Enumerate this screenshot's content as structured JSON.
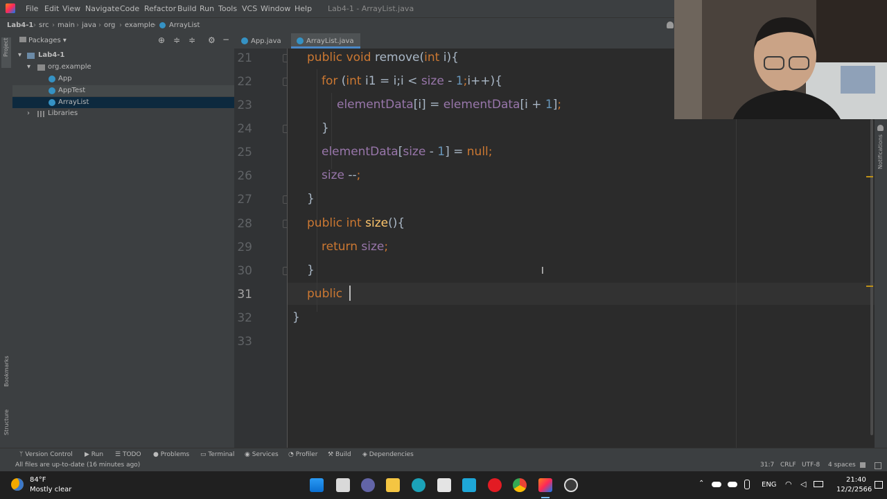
{
  "window": {
    "title": "Lab4-1 - ArrayList.java"
  },
  "menu": [
    "File",
    "Edit",
    "View",
    "Navigate",
    "Code",
    "Refactor",
    "Build",
    "Run",
    "Tools",
    "VCS",
    "Window",
    "Help"
  ],
  "breadcrumb": [
    "Lab4-1",
    "src",
    "main",
    "java",
    "org",
    "example",
    "ArrayList"
  ],
  "project_panel": {
    "title": "Packages",
    "tree": [
      {
        "label": "Lab4-1",
        "indent": 0,
        "expanded": true
      },
      {
        "label": "org.example",
        "indent": 1,
        "expanded": true
      },
      {
        "label": "App",
        "indent": 2
      },
      {
        "label": "AppTest",
        "indent": 2,
        "highlight": "test"
      },
      {
        "label": "ArrayList",
        "indent": 2,
        "selected": true
      },
      {
        "label": "Libraries",
        "indent": 1,
        "expanded": false
      }
    ]
  },
  "tabs": [
    {
      "label": "App.java",
      "active": false
    },
    {
      "label": "ArrayList.java",
      "active": true
    }
  ],
  "editor": {
    "line_numbers": [
      "21",
      "22",
      "23",
      "24",
      "25",
      "26",
      "27",
      "28",
      "29",
      "30",
      "31",
      "32",
      "33"
    ],
    "current_line": "31",
    "lines": [
      [
        [
          "kw",
          "public "
        ],
        [
          "kw",
          "void "
        ],
        [
          "plain",
          "remove("
        ],
        [
          "kw",
          "int "
        ],
        [
          "plain",
          "i){"
        ]
      ],
      [
        [
          "kw",
          "for "
        ],
        [
          "plain",
          "("
        ],
        [
          "kw",
          "int "
        ],
        [
          "plain",
          "i1 = i;i < "
        ],
        [
          "fld",
          "size"
        ],
        [
          "plain",
          " - "
        ],
        [
          "num",
          "1"
        ],
        [
          "kw",
          ";"
        ],
        [
          "plain",
          "i++){"
        ]
      ],
      [
        [
          "fld",
          "elementData"
        ],
        [
          "plain",
          "[i] = "
        ],
        [
          "fld",
          "elementData"
        ],
        [
          "plain",
          "[i + "
        ],
        [
          "num",
          "1"
        ],
        [
          "plain",
          "]"
        ],
        [
          "kw",
          ";"
        ]
      ],
      [
        [
          "plain",
          "}"
        ]
      ],
      [
        [
          "fld",
          "elementData"
        ],
        [
          "plain",
          "["
        ],
        [
          "fld",
          "size"
        ],
        [
          "plain",
          " - "
        ],
        [
          "num",
          "1"
        ],
        [
          "plain",
          "] = "
        ],
        [
          "kw",
          "null"
        ],
        [
          "kw",
          ";"
        ]
      ],
      [
        [
          "fld",
          "size"
        ],
        [
          "plain",
          " --"
        ],
        [
          "kw",
          ";"
        ]
      ],
      [
        [
          "plain",
          "}"
        ]
      ],
      [
        [
          "kw",
          "public "
        ],
        [
          "kw",
          "int "
        ],
        [
          "fn",
          "size"
        ],
        [
          "plain",
          "(){"
        ]
      ],
      [
        [
          "kw",
          "return "
        ],
        [
          "fld",
          "size"
        ],
        [
          "kw",
          ";"
        ]
      ],
      [
        [
          "plain",
          "}"
        ]
      ],
      [
        [
          "kw",
          "public "
        ]
      ],
      [
        [
          "plain",
          "}"
        ]
      ],
      []
    ]
  },
  "right_strip": {
    "label": "Notifications"
  },
  "left_strip": {
    "project": "Project",
    "bookmarks": "Bookmarks",
    "structure": "Structure"
  },
  "tool_windows": [
    "Version Control",
    "Run",
    "TODO",
    "Problems",
    "Terminal",
    "Services",
    "Profiler",
    "Build",
    "Dependencies"
  ],
  "status": {
    "message": "All files are up-to-date (16 minutes ago)",
    "position": "31:7",
    "line_sep": "CRLF",
    "encoding": "UTF-8",
    "indent": "4 spaces"
  },
  "taskbar": {
    "weather_temp": "84°F",
    "weather_desc": "Mostly clear",
    "lang": "ENG",
    "time": "21:40",
    "date": "12/2/2566"
  },
  "colors": {
    "keyword": "#cc7832",
    "field": "#9876aa",
    "number": "#6897bb",
    "method": "#ffc66d",
    "plain": "#a9b7c6",
    "selection": "#0d293e"
  }
}
